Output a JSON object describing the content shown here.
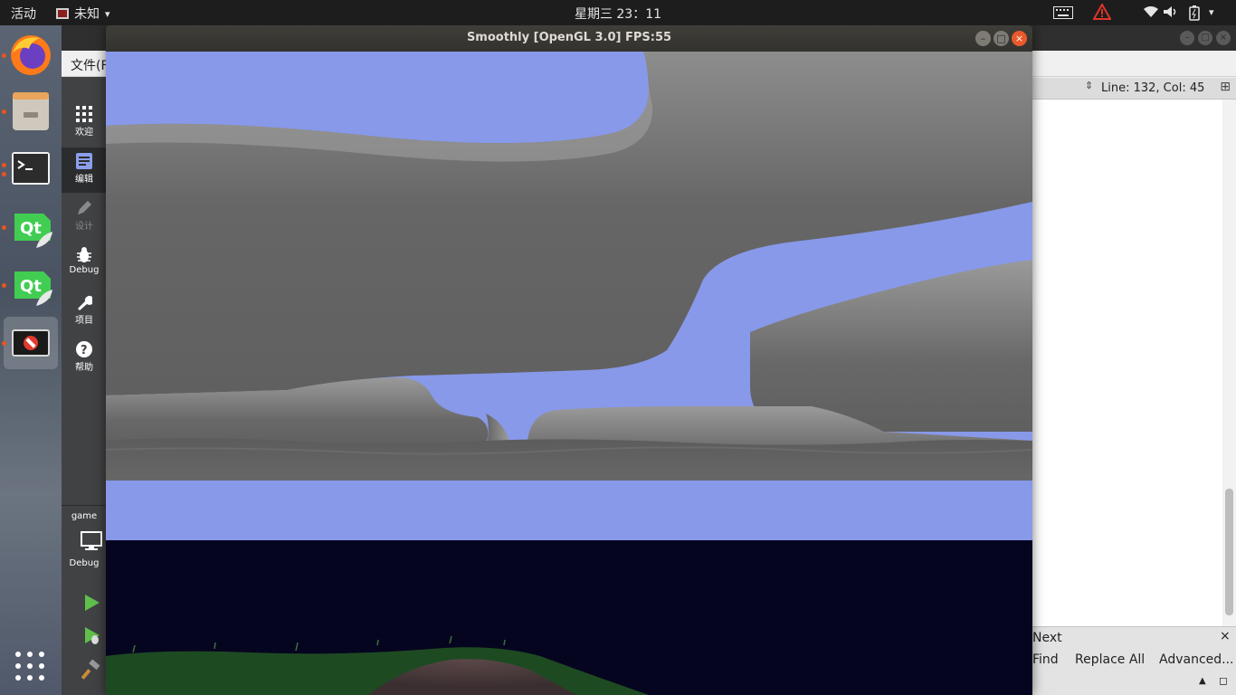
{
  "topbar": {
    "activities": "活动",
    "app_name": "未知",
    "clock": "星期三 23：11",
    "tray_icons": [
      "keyboard-icon",
      "warning-icon",
      "wifi-icon",
      "volume-icon",
      "battery-icon",
      "system-menu-icon"
    ]
  },
  "dock": {
    "items": [
      {
        "name": "firefox",
        "icon": "firefox-icon"
      },
      {
        "name": "files",
        "icon": "file-manager-icon"
      },
      {
        "name": "terminal",
        "icon": "terminal-icon"
      },
      {
        "name": "qt-creator-1",
        "icon": "qt-icon",
        "label": "Qt"
      },
      {
        "name": "qt-creator-2",
        "icon": "qt-icon",
        "label": "Qt"
      },
      {
        "name": "running-app",
        "icon": "no-entry-icon"
      }
    ],
    "show_apps_icon": "grid-icon"
  },
  "qt": {
    "menu_file": "文件(F",
    "modes": [
      {
        "label": "欢迎",
        "icon": "grid-icon"
      },
      {
        "label": "编辑",
        "icon": "edit-icon"
      },
      {
        "label": "设计",
        "icon": "pencil-icon"
      },
      {
        "label": "Debug",
        "icon": "bug-icon"
      },
      {
        "label": "项目",
        "icon": "wrench-icon"
      },
      {
        "label": "帮助",
        "icon": "help-icon"
      }
    ],
    "kit": {
      "project": "game",
      "config": "Debug"
    },
    "editor": {
      "line_col": "Line: 132, Col: 45"
    },
    "find": {
      "next": "Next",
      "find": "Find",
      "replace_all": "Replace All",
      "advanced": "Advanced..."
    }
  },
  "gl_window": {
    "title": "Smoothly [OpenGL 3.0] FPS:55"
  },
  "colors": {
    "sky": "#8899e9",
    "terrain": "#646464",
    "night": "#06051f",
    "grass": "#1e4a22",
    "dirt": "#4a3a3a",
    "accent": "#e95420"
  }
}
